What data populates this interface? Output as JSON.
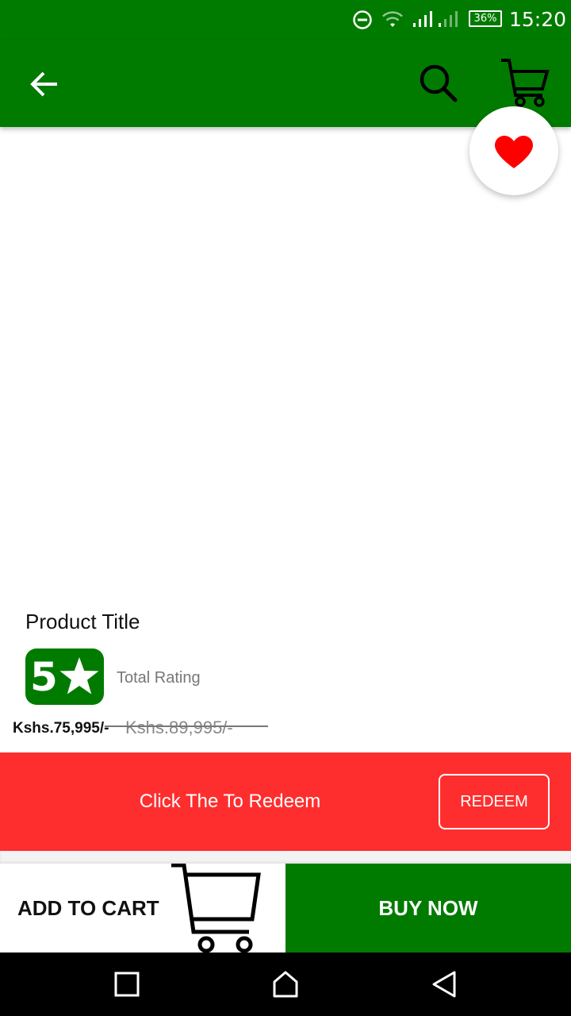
{
  "status_bar": {
    "time": "15:20",
    "battery": "36%",
    "icons": [
      "do-not-disturb-icon",
      "wifi-icon",
      "signal-icon",
      "signal-weak-icon",
      "battery-icon"
    ]
  },
  "app_bar": {
    "back_icon": "arrow-left-icon",
    "search_icon": "search-icon",
    "cart_icon": "cart-icon"
  },
  "favorite": {
    "icon": "heart-icon",
    "color": "#ff0000"
  },
  "product": {
    "title": "Product Title",
    "rating_value": "5",
    "rating_label": "Total Rating",
    "price": "Kshs.75,995/-",
    "old_price": "Kshs.89,995/-"
  },
  "redeem": {
    "message": "Click The To Redeem",
    "button_label": "REDEEM"
  },
  "actions": {
    "add_to_cart": "ADD TO CART",
    "buy_now": "BUY NOW"
  },
  "navigation": {
    "items": [
      "recents-icon",
      "home-icon",
      "back-icon"
    ]
  },
  "colors": {
    "brand_green": "#007b00",
    "banner_red": "#ff2e2e",
    "nav_black": "#000000"
  }
}
